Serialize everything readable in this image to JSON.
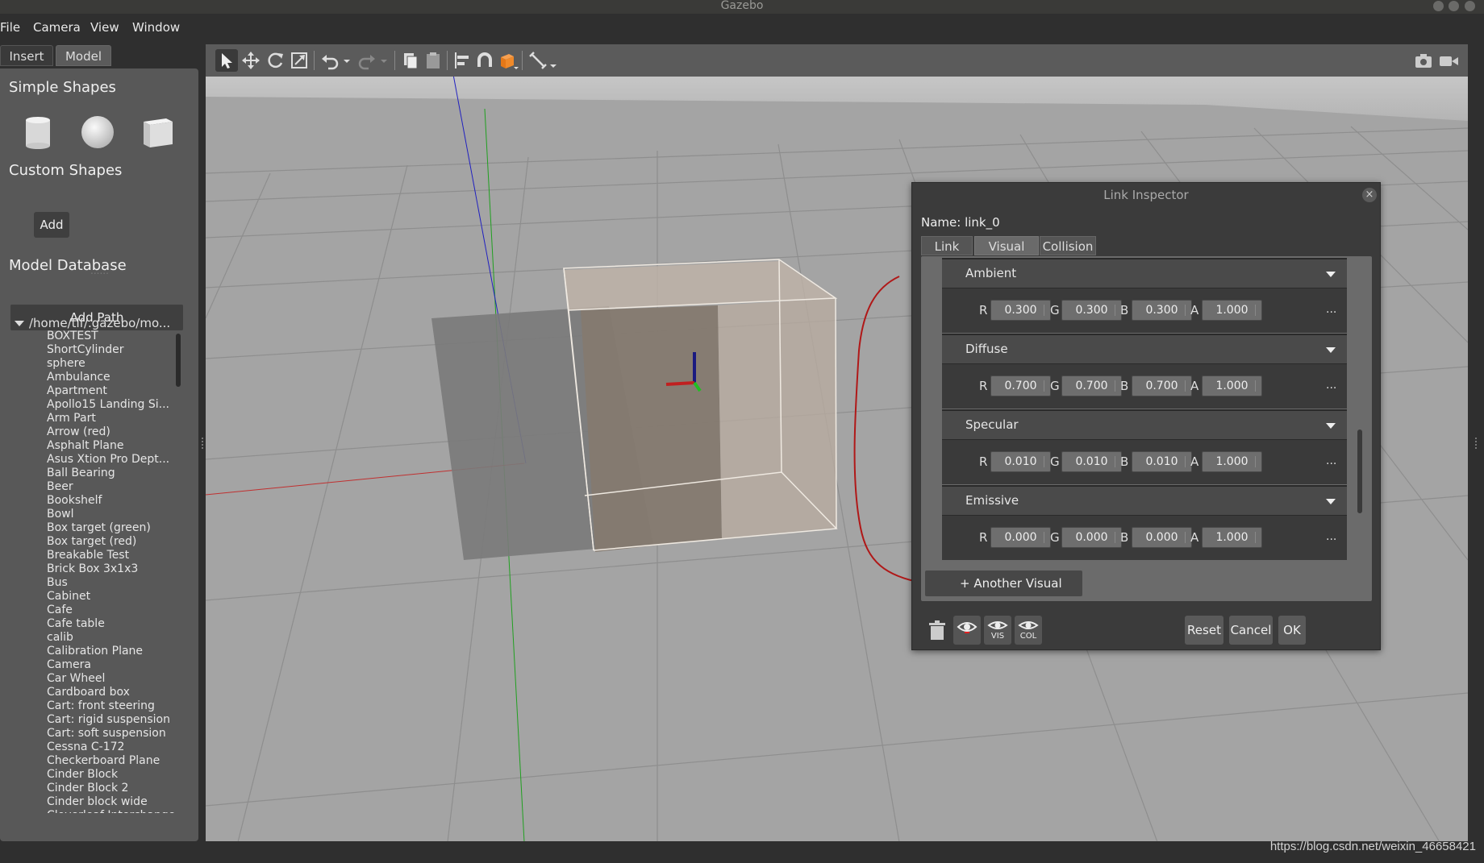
{
  "window": {
    "title": "Gazebo"
  },
  "menu": [
    "File",
    "Camera",
    "View",
    "Window"
  ],
  "left_panel": {
    "tabs": [
      "Insert",
      "Model"
    ],
    "simple_shapes_title": "Simple Shapes",
    "shapes": [
      "cylinder",
      "sphere",
      "box"
    ],
    "custom_shapes_title": "Custom Shapes",
    "add_label": "Add",
    "splitter": "......",
    "model_database_title": "Model Database",
    "add_path_label": "Add Path",
    "tree_root": "/home/tlf/.gazebo/mo...",
    "models": [
      "BOXTEST",
      "ShortCylinder",
      "sphere",
      "Ambulance",
      "Apartment",
      "Apollo15 Landing Si...",
      "Arm Part",
      "Arrow (red)",
      "Asphalt Plane",
      "Asus Xtion Pro Dept...",
      "Ball Bearing",
      "Beer",
      "Bookshelf",
      "Bowl",
      "Box target (green)",
      "Box target (red)",
      "Breakable Test",
      "Brick Box 3x1x3",
      "Bus",
      "Cabinet",
      "Cafe",
      "Cafe table",
      "calib",
      "Calibration Plane",
      "Camera",
      "Car Wheel",
      "Cardboard box",
      "Cart: front steering",
      "Cart: rigid suspension",
      "Cart: soft suspension",
      "Cessna C-172",
      "Checkerboard Plane",
      "Cinder Block",
      "Cinder Block 2",
      "Cinder block wide",
      "Cloverleaf Interchange"
    ]
  },
  "toolbar": {
    "tools": [
      "select-mode",
      "translate-mode",
      "rotate-mode",
      "scale-mode",
      "undo",
      "undo-history",
      "redo",
      "redo-history",
      "copy",
      "paste",
      "align",
      "snap",
      "change-view",
      "view-angle",
      "measure",
      "measure-menu",
      "screenshot",
      "record-video"
    ]
  },
  "link_inspector": {
    "title": "Link Inspector",
    "close": "×",
    "name_label": "Name:",
    "name_value": "link_0",
    "tabs": [
      "Link",
      "Visual",
      "Collision"
    ],
    "active_tab": "Visual",
    "channel_labels": [
      "R",
      "G",
      "B",
      "A"
    ],
    "more": "...",
    "groups": [
      {
        "label": "Ambient",
        "values": [
          "0.300",
          "0.300",
          "0.300",
          "1.000"
        ]
      },
      {
        "label": "Diffuse",
        "values": [
          "0.700",
          "0.700",
          "0.700",
          "1.000"
        ]
      },
      {
        "label": "Specular",
        "values": [
          "0.010",
          "0.010",
          "0.010",
          "1.000"
        ]
      },
      {
        "label": "Emissive",
        "values": [
          "0.000",
          "0.000",
          "0.000",
          "1.000"
        ]
      }
    ],
    "another_visual": "+ Another Visual",
    "vis_label": "VIS",
    "col_label": "COL",
    "reset": "Reset",
    "cancel": "Cancel",
    "ok": "OK"
  },
  "watermark": "https://blog.csdn.net/weixin_46658421",
  "colors": {
    "annotation": "#b01818",
    "axis_x": "#d03030",
    "axis_y": "#30c030",
    "axis_z": "#2030c0",
    "selection_box": "#c8b8a8"
  }
}
